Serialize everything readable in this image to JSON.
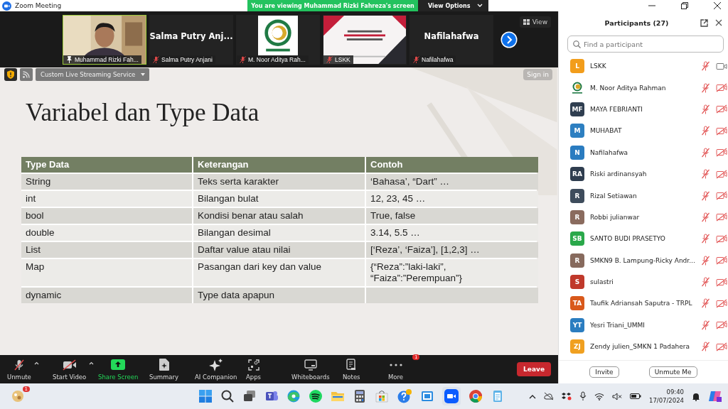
{
  "window": {
    "title": "Zoom Meeting"
  },
  "share_banner": {
    "text": "You are viewing Muhammad Rizki Fahreza's screen",
    "button": "View Options"
  },
  "gallery": {
    "view_label": "View",
    "tiles": [
      {
        "kind": "video",
        "name": "Muhammad Rizki Fah...",
        "pinned": true,
        "active": true
      },
      {
        "kind": "name",
        "display": "Salma Putry Anj...",
        "name": "Salma Putry Anjani",
        "pinned": false,
        "active": false
      },
      {
        "kind": "logo",
        "name": "M. Noor Aditya Rah...",
        "pinned": false,
        "active": false
      },
      {
        "kind": "slide",
        "name": "LSKK",
        "pinned": false,
        "active": false
      },
      {
        "kind": "name",
        "display": "Nafilahafwa",
        "name": "Nafilahafwa",
        "pinned": false,
        "active": false
      }
    ]
  },
  "streaming": {
    "label": "Custom Live Streaming Service",
    "sign_in": "Sign in"
  },
  "slide": {
    "title": "Variabel dan Type Data",
    "columns": [
      "Type Data",
      "Keterangan",
      "Contoh"
    ],
    "rows": [
      [
        "String",
        "Teks serta karakter",
        "‘Bahasa’, “Dart” …"
      ],
      [
        "int",
        "Bilangan bulat",
        "12, 23, 45 …"
      ],
      [
        "bool",
        "Kondisi benar atau salah",
        "True, false"
      ],
      [
        "double",
        "Bilangan desimal",
        "3.14, 5.5 …"
      ],
      [
        "List",
        "Daftar value atau nilai",
        "[‘Reza’, ‘Faiza’], [1,2,3] …"
      ],
      [
        "Map",
        "Pasangan dari key dan value",
        "{“Reza”:”laki-laki”,\n“Faiza”:”Perempuan”}"
      ],
      [
        "dynamic",
        "Type data apapun",
        ""
      ]
    ]
  },
  "toolbar": {
    "leave": "Leave",
    "items": [
      {
        "kind": "mic",
        "label": "Unmute",
        "off": true,
        "menu": true
      },
      {
        "kind": "video",
        "label": "Start Video",
        "off": true,
        "menu": true
      },
      {
        "kind": "share",
        "label": "Share Screen"
      },
      {
        "kind": "summary",
        "label": "Summary"
      },
      {
        "kind": "ai",
        "label": "AI Companion"
      },
      {
        "kind": "apps",
        "label": "Apps"
      },
      {
        "kind": "whiteboard",
        "label": "Whiteboards"
      },
      {
        "kind": "notes",
        "label": "Notes"
      },
      {
        "kind": "more",
        "label": "More",
        "badge": "1"
      }
    ]
  },
  "participants": {
    "title": "Participants (27)",
    "search_placeholder": "Find a participant",
    "buttons": [
      "Invite",
      "Unmute Me"
    ],
    "items": [
      {
        "name": "LSKK",
        "kind": "initials",
        "initials": "L",
        "color": "#f29d1b",
        "mic_muted": true,
        "video_off": false
      },
      {
        "name": "M. Noor Aditya Rahman",
        "kind": "picture",
        "mic_muted": true,
        "video_off": true
      },
      {
        "name": "MAYA FEBRIANTI",
        "kind": "initials",
        "initials": "MF",
        "color": "#2f3e50",
        "mic_muted": true,
        "video_off": true
      },
      {
        "name": "MUHABAT",
        "kind": "initials",
        "initials": "M",
        "color": "#2d7fc1",
        "mic_muted": true,
        "video_off": true
      },
      {
        "name": "Nafilahafwa",
        "kind": "initials",
        "initials": "N",
        "color": "#2a7cc0",
        "mic_muted": true,
        "video_off": true
      },
      {
        "name": "Riski ardinansyah",
        "kind": "initials",
        "initials": "RA",
        "color": "#2f3d4f",
        "mic_muted": true,
        "video_off": true
      },
      {
        "name": "Rizal Setiawan",
        "kind": "initials",
        "initials": "R",
        "color": "#3e4c5c",
        "mic_muted": true,
        "video_off": true
      },
      {
        "name": "Robbi julianwar",
        "kind": "initials",
        "initials": "R",
        "color": "#8a6b5e",
        "mic_muted": true,
        "video_off": true
      },
      {
        "name": "SANTO BUDI PRASETYO",
        "kind": "initials",
        "initials": "SB",
        "color": "#2aa84a",
        "mic_muted": true,
        "video_off": true
      },
      {
        "name": "SMKN9 B. Lampung-Ricky Andr...",
        "kind": "initials",
        "initials": "R",
        "color": "#876a5d",
        "mic_muted": true,
        "video_off": true
      },
      {
        "name": "sulastri",
        "kind": "initials",
        "initials": "S",
        "color": "#c0392b",
        "mic_muted": true,
        "video_off": true
      },
      {
        "name": "Taufik Adriansah Saputra - TRPL",
        "kind": "initials",
        "initials": "TA",
        "color": "#d9591b",
        "mic_muted": true,
        "video_off": true
      },
      {
        "name": "Yesri Triani_UMMI",
        "kind": "initials",
        "initials": "YT",
        "color": "#2b7dc0",
        "mic_muted": true,
        "video_off": true
      },
      {
        "name": "Zendy julien_SMKN 1 Padahera",
        "kind": "initials",
        "initials": "ZJ",
        "color": "#f0a020",
        "mic_muted": true,
        "video_off": true
      }
    ]
  },
  "taskbar": {
    "widget_badge": "1",
    "time": "09:40",
    "date": "17/07/2024"
  }
}
